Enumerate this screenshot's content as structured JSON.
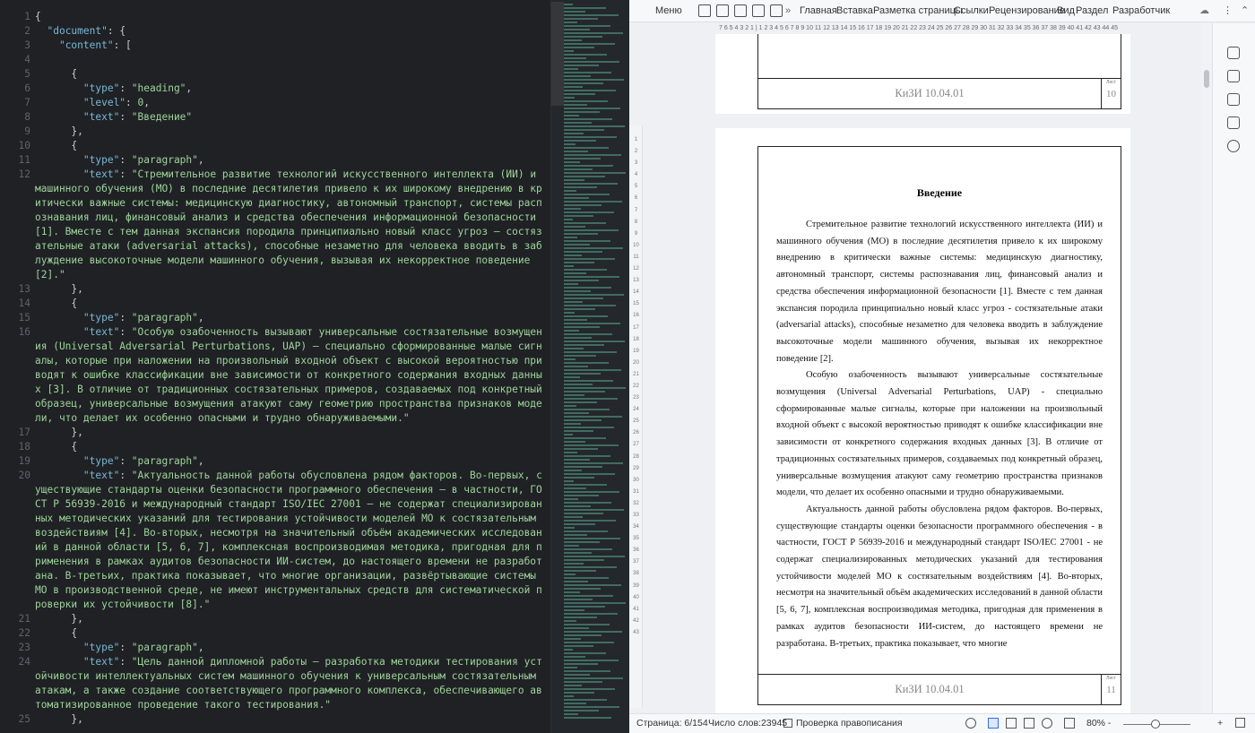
{
  "editor": {
    "line_numbers": [
      1,
      2,
      3,
      4,
      5,
      6,
      7,
      8,
      9,
      10,
      11,
      12,
      "",
      "",
      "",
      "",
      "",
      "",
      "",
      13,
      14,
      15,
      16,
      "",
      "",
      "",
      "",
      "",
      "",
      17,
      18,
      19,
      20,
      "",
      "",
      "",
      "",
      "",
      "",
      "",
      "",
      "",
      21,
      22,
      23,
      24,
      "",
      "",
      ""
    ],
    "lines": [
      {
        "tokens": [
          {
            "t": "{",
            "c": "p"
          }
        ],
        "rows": 1
      },
      {
        "tokens": [
          {
            "t": "  \"document\"",
            "c": "k"
          },
          {
            "t": ": {",
            "c": "p"
          }
        ],
        "rows": 1
      },
      {
        "tokens": [
          {
            "t": "    \"content\"",
            "c": "k"
          },
          {
            "t": ": [",
            "c": "p"
          }
        ],
        "rows": 1
      },
      {
        "tokens": [
          {
            "t": "",
            "c": "p"
          }
        ],
        "rows": 1
      },
      {
        "tokens": [
          {
            "t": "      {",
            "c": "p"
          }
        ],
        "rows": 1
      },
      {
        "tokens": [
          {
            "t": "        \"type\"",
            "c": "k"
          },
          {
            "t": ": ",
            "c": "p"
          },
          {
            "t": "\"heading\"",
            "c": "s"
          },
          {
            "t": ",",
            "c": "p"
          }
        ],
        "rows": 1
      },
      {
        "tokens": [
          {
            "t": "        \"level\"",
            "c": "k"
          },
          {
            "t": ": ",
            "c": "p"
          },
          {
            "t": "0",
            "c": "s"
          },
          {
            "t": ",",
            "c": "p"
          }
        ],
        "rows": 1
      },
      {
        "tokens": [
          {
            "t": "        \"text\"",
            "c": "k"
          },
          {
            "t": ": ",
            "c": "p"
          },
          {
            "t": "\"Введение\"",
            "c": "s"
          }
        ],
        "rows": 1
      },
      {
        "tokens": [
          {
            "t": "      },",
            "c": "p"
          }
        ],
        "rows": 1
      },
      {
        "tokens": [
          {
            "t": "      {",
            "c": "p"
          }
        ],
        "rows": 1
      },
      {
        "tokens": [
          {
            "t": "        \"type\"",
            "c": "k"
          },
          {
            "t": ": ",
            "c": "p"
          },
          {
            "t": "\"paragraph\"",
            "c": "s"
          },
          {
            "t": ",",
            "c": "p"
          }
        ],
        "rows": 1
      },
      {
        "tokens": [
          {
            "t": "        \"text\"",
            "c": "k"
          },
          {
            "t": ": ",
            "c": "p"
          },
          {
            "t": "\"Стремительное развитие технологий искусственного интеллекта (ИИ) и машинного обучения (МО) в последние десятилетия привело к их широкому внедрению в критически важные системы: медицинскую диагностику, автономный транспорт, системы распознавания лиц, финансовый анализ и средства обеспечения информационной безопасности [1]. Вместе с тем данная экспансия породила принципиально новый класс угроз — состязательные атаки (adversarial attacks), способные незаметно для человека вводить в заблуждение высокоточные модели машинного обучения, вызывая их некорректное поведение [2].\"",
            "c": "s"
          }
        ],
        "rows": 8
      },
      {
        "tokens": [
          {
            "t": "      },",
            "c": "p"
          }
        ],
        "rows": 1
      },
      {
        "tokens": [
          {
            "t": "      {",
            "c": "p"
          }
        ],
        "rows": 1
      },
      {
        "tokens": [
          {
            "t": "        \"type\"",
            "c": "k"
          },
          {
            "t": ": ",
            "c": "p"
          },
          {
            "t": "\"paragraph\"",
            "c": "s"
          },
          {
            "t": ",",
            "c": "p"
          }
        ],
        "rows": 1
      },
      {
        "tokens": [
          {
            "t": "        \"text\"",
            "c": "k"
          },
          {
            "t": ": ",
            "c": "p"
          },
          {
            "t": "\"Особую озабоченность вызывают универсальные состязательные возмущения (Universal Adversarial Perturbations, UAP) — специально сформированные малые сигналы, которые при наложении на произвольный входной объект с высокой вероятностью приводят к ошибке классификации вне зависимости от конкретного содержания входных данных [3]. В отличие от традиционных состязательных примеров, создаваемых под конкретный образец, универсальные возмущения атакуют саму геометрию пространства признаков модели, что делает их особенно опасными и трудно обнаруживаемыми.\"",
            "c": "s"
          }
        ],
        "rows": 7
      },
      {
        "tokens": [
          {
            "t": "      },",
            "c": "p"
          }
        ],
        "rows": 1
      },
      {
        "tokens": [
          {
            "t": "      {",
            "c": "p"
          }
        ],
        "rows": 1
      },
      {
        "tokens": [
          {
            "t": "        \"type\"",
            "c": "k"
          },
          {
            "t": ": ",
            "c": "p"
          },
          {
            "t": "\"paragraph\"",
            "c": "s"
          },
          {
            "t": ",",
            "c": "p"
          }
        ],
        "rows": 1
      },
      {
        "tokens": [
          {
            "t": "        \"text\"",
            "c": "k"
          },
          {
            "t": ": ",
            "c": "p"
          },
          {
            "t": "\"Актуальность данной работы обусловлена рядом факторов. Во-первых, существующие стандарты оценки безопасности программного обеспечения — в частности, ГОСТ Р 56939-2016 и международный стандарт ISO/IEC 27001 — не содержат специализированных методических указаний для тестирования устойчивости моделей МО к состязательным воздействиям [4]. Во-вторых, несмотря на значительный объём академических исследований в данной области [5, 6, 7], комплексная воспроизводимая методика, пригодная для применения в рамках аудитов безопасности ИИ-систем, до настоящего времени не разработана. В-третьих, практика показывает, что многие организации, развёртывающие системы МО в производственной среде, не имеют инструментальных средств для систематической проверки их устойчивости [8].\"",
            "c": "s"
          }
        ],
        "rows": 10
      },
      {
        "tokens": [
          {
            "t": "      },",
            "c": "p"
          }
        ],
        "rows": 1
      },
      {
        "tokens": [
          {
            "t": "      {",
            "c": "p"
          }
        ],
        "rows": 1
      },
      {
        "tokens": [
          {
            "t": "        \"type\"",
            "c": "k"
          },
          {
            "t": ": ",
            "c": "p"
          },
          {
            "t": "\"paragraph\"",
            "c": "s"
          },
          {
            "t": ",",
            "c": "p"
          }
        ],
        "rows": 1
      },
      {
        "tokens": [
          {
            "t": "        \"text\"",
            "c": "k"
          },
          {
            "t": ": ",
            "c": "p"
          },
          {
            "t": "\"Цель данной дипломной работы — разработка методики тестирования устойчивости интеллектуальных систем машинного обучения к универсальным состязательным атакам, а также создание соответствующего программного комплекса, обеспечивающего автоматизированное проведение такого тестирования.\"",
            "c": "s"
          }
        ],
        "rows": 4
      },
      {
        "tokens": [
          {
            "t": "      },",
            "c": "p"
          }
        ],
        "rows": 1
      }
    ]
  },
  "writer": {
    "menu_label": "Меню",
    "tabs": [
      "Главная",
      "Вставка",
      "Разметка страницы",
      "Ссылки",
      "Рецензирование",
      "Вид",
      "Раздел",
      "Разработчик"
    ],
    "active_tab": "Главная",
    "ruler_h": "7 6 5 4 3 2 1 | 1 2 3 4 5 6 7 8 9 10 11 12 13 14 15 16 17 18 19 20 21 22 23 24 25 26 27 28 29 30 31 32 33 34 35 36 37 38 39 40 41 42 43 44 45",
    "stamp_code": "КиЗИ 10.04.01",
    "sheet_label": "Лист",
    "prev_page_no": "10",
    "cur_page_no": "11",
    "heading": "Введение",
    "paragraphs": [
      "Стремительное развитие технологий искусственного интеллекта (ИИ) и машинного обучения (МО) в последние десятилетия привело к их широкому внедрению в критически важные системы: медицинскую диагностику, автономный транспорт, системы распознавания лиц, финансовый анализ и средства обеспечения информационной безопасности [1]. Вместе с тем данная экспансия породила принципиально новый класс угроз - состязательные атаки (adversarial attacks), способные незаметно для человека вводить в заблуждение высокоточные модели машинного обучения, вызывая их некорректное поведение [2].",
      "Особую озабоченность вызывают универсальные состязательные возмущения (Universal Adversarial Perturbations, UAP) - специально сформированные малые сигналы, которые при наложении на произвольный входной объект с высокой вероятностью приводят к ошибке классификации вне зависимости от конкретного содержания входных данных [3]. В отличие от традиционных состязательных примеров, создаваемых под конкретный образец, универсальные возмущения атакуют саму геометрию пространства признаков модели, что делает их особенно опасными и трудно обнаруживаемыми.",
      "Актуальность данной работы обусловлена рядом факторов. Во-первых, существующие стандарты оценки безопасности программного обеспечения - в частности, ГОСТ Р 56939-2016 и международный стандарт ISO/IEC 27001 - не содержат специализированных методических указаний для тестирования устойчивости моделей МО к состязательным воздействиям [4]. Во-вторых, несмотря на значительный объём академических исследований в данной области [5, 6, 7], комплексная воспроизводимая методика, пригодная для применения в рамках аудитов безопасности ИИ-систем, до настоящего времени не разработана. В-третьих, практика показывает, что многие"
    ],
    "status": {
      "page": "Страница: 6/154",
      "words": "Число слов:23945",
      "spell": "Проверка правописания",
      "zoom": "80% -"
    }
  }
}
